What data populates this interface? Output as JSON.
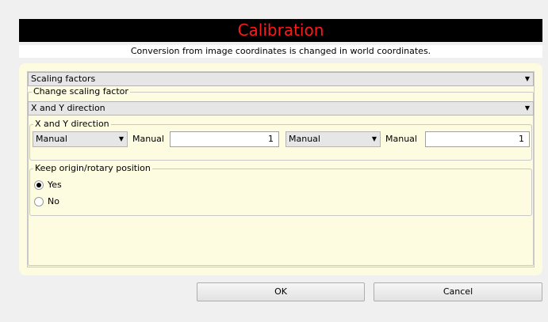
{
  "title": "Calibration",
  "subtitle": "Conversion from image coordinates is changed in world coordinates.",
  "scaling_select": {
    "value": "Scaling factors"
  },
  "change_group": {
    "label": "Change scaling factor"
  },
  "direction_select": {
    "value": "X and Y direction"
  },
  "xy_group": {
    "label": "X and Y direction",
    "x_mode": "Manual",
    "x_label": "Manual",
    "x_value": "1",
    "y_mode": "Manual",
    "y_label": "Manual",
    "y_value": "1"
  },
  "origin_group": {
    "label": "Keep origin/rotary position",
    "options": [
      {
        "label": "Yes",
        "selected": true
      },
      {
        "label": "No",
        "selected": false
      }
    ]
  },
  "buttons": {
    "ok": "OK",
    "cancel": "Cancel"
  },
  "colors": {
    "title_bg": "#000000",
    "title_text": "#ff1a1a",
    "panel_bg": "#fdfbe0"
  }
}
